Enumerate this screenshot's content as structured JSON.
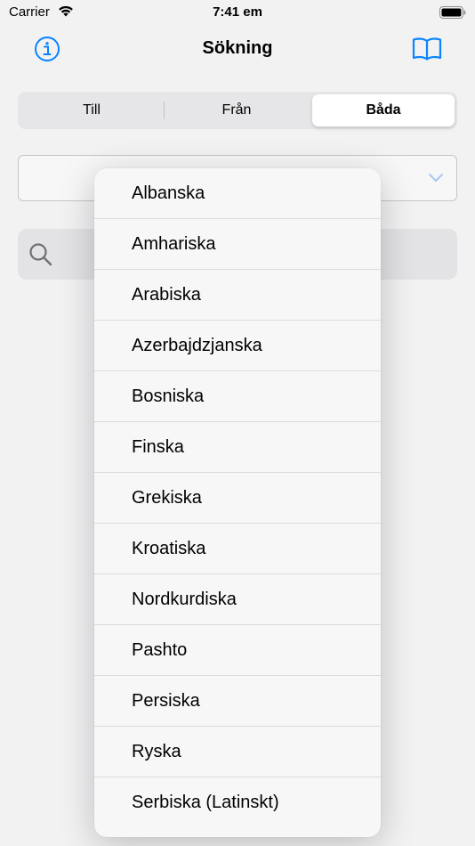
{
  "status_bar": {
    "carrier": "Carrier",
    "time": "7:41 em"
  },
  "nav": {
    "title": "Sökning"
  },
  "segments": [
    "Till",
    "Från",
    "Båda"
  ],
  "selected_segment": "Båda",
  "colors": {
    "accent": "#0a84ff",
    "chevron": "#a9c7f2"
  },
  "language_menu": {
    "items": [
      "Albanska",
      "Amhariska",
      "Arabiska",
      "Azerbajdzjanska",
      "Bosniska",
      "Finska",
      "Grekiska",
      "Kroatiska",
      "Nordkurdiska",
      "Pashto",
      "Persiska",
      "Ryska",
      "Serbiska (Latinskt)"
    ]
  }
}
